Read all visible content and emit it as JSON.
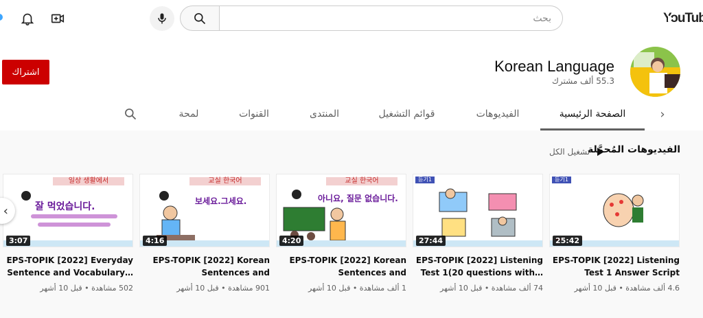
{
  "app": {
    "logo_text": "YouTube"
  },
  "search": {
    "placeholder": "بحث"
  },
  "channel": {
    "name": "Korean Language",
    "subscribers": "55.3 ألف مشترك",
    "subscribe_label": "اشتراك"
  },
  "tabs": [
    {
      "label": "الصفحة الرئيسية",
      "active": true
    },
    {
      "label": "الفيديوهات",
      "active": false
    },
    {
      "label": "قوائم التشغيل",
      "active": false
    },
    {
      "label": "المنتدى",
      "active": false
    },
    {
      "label": "القنوات",
      "active": false
    },
    {
      "label": "لمحة",
      "active": false
    }
  ],
  "section": {
    "title": "الفيديوهات المُحمَّلة",
    "play_all": "تشغيل الكل"
  },
  "videos": [
    {
      "title_line1": "EPS-TOPIK [2022] Listening",
      "title_line2": "Test 1 Answer Script",
      "meta": "4.6 ألف مشاهدة • قبل 10 أشهر",
      "duration": "25:42",
      "thumb_banner": "듣기1",
      "thumb_text": "",
      "accent": "#e3f2fd"
    },
    {
      "title_line1": "EPS-TOPIK [2022] Listening",
      "title_line2": "Test 1(20 questions with…",
      "meta": "74 ألف مشاهدة • قبل 10 أشهر",
      "duration": "27:44",
      "thumb_banner": "듣기1",
      "thumb_text": "",
      "accent": "#e3f2fd"
    },
    {
      "title_line1": "EPS-TOPIK [2022] Korean",
      "title_line2": "Sentences and Vocabulary…",
      "meta": "1 ألف مشاهدة • قبل 10 أشهر",
      "duration": "4:20",
      "thumb_banner": "교실 한국어",
      "thumb_text": "아니요, 질문 없습니다.",
      "accent": "#fde8e8"
    },
    {
      "title_line1": "EPS-TOPIK [2022] Korean",
      "title_line2": "Sentences and Vocabulary…",
      "meta": "901 مشاهدة • قبل 10 أشهر",
      "duration": "4:16",
      "thumb_banner": "교실 한국어",
      "thumb_text": "보세요.그세요.",
      "accent": "#fde8e8"
    },
    {
      "title_line1": "EPS-TOPIK [2022] Everyday",
      "title_line2": "Sentence and Vocabulary…",
      "meta": "502 مشاهدة • قبل 10 أشهر",
      "duration": "3:07",
      "thumb_banner": "일상 생활에서",
      "thumb_text": "잘 먹었습니다.",
      "accent": "#fde8e8"
    }
  ],
  "colors": {
    "brand": "#ff0000",
    "subscribe": "#cc0000",
    "text_secondary": "#606060"
  }
}
